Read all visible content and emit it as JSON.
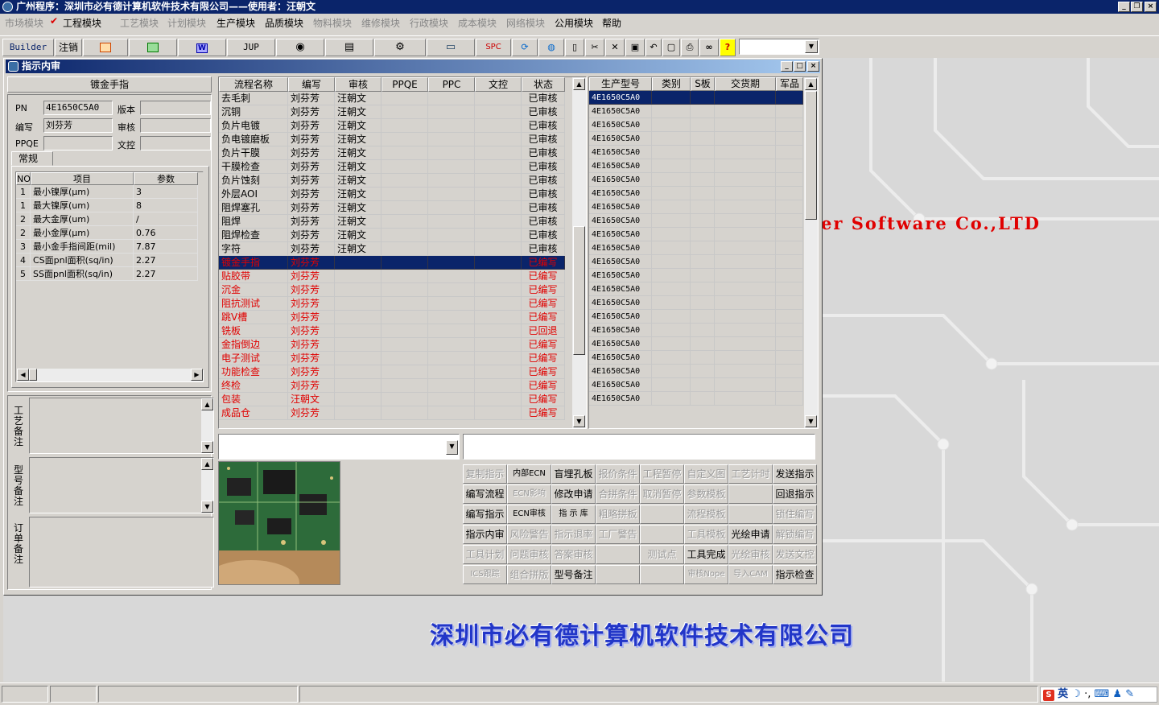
{
  "title_bar": {
    "title": "广州程序：深圳市必有德计算机软件技术有限公司——使用者：汪朝文"
  },
  "menu": [
    {
      "label": "市场模块",
      "enabled": false
    },
    {
      "label": "工程模块",
      "enabled": true,
      "checked": true
    },
    {
      "label": "工艺模块",
      "enabled": false
    },
    {
      "label": "计划模块",
      "enabled": false
    },
    {
      "label": "生产模块",
      "enabled": true
    },
    {
      "label": "品质模块",
      "enabled": true
    },
    {
      "label": "物料模块",
      "enabled": false
    },
    {
      "label": "维修模块",
      "enabled": false
    },
    {
      "label": "行政模块",
      "enabled": false
    },
    {
      "label": "成本模块",
      "enabled": false
    },
    {
      "label": "网络模块",
      "enabled": false
    },
    {
      "label": "公用模块",
      "enabled": true
    },
    {
      "label": "帮助",
      "enabled": true
    }
  ],
  "toolbar": {
    "builder": "Builder",
    "logout": "注销",
    "jup": "JUP",
    "spc": "SPC"
  },
  "desktop": {
    "company_en": "er Software Co.,LTD",
    "company_cn": "深圳市必有德计算机软件技术有限公司"
  },
  "window": {
    "title": "指示内审"
  },
  "left": {
    "header": "镀金手指",
    "pn_label": "PN",
    "pn_value": "4E1650C5A0",
    "version_label": "版本",
    "version_value": "",
    "author_label": "编写",
    "author_value": "刘芬芳",
    "review_label": "审核",
    "review_value": "",
    "ppqe_label": "PPQE",
    "ppqe_value": "",
    "doc_review_label": "文控",
    "doc_review_value": "",
    "tab_label": "常规",
    "param_headers": [
      "NO",
      "项目",
      "参数"
    ],
    "params": [
      [
        "1",
        "最小镍厚(μm)",
        "3"
      ],
      [
        "1",
        "最大镍厚(um)",
        "8"
      ],
      [
        "2",
        "最大金厚(um)",
        "/"
      ],
      [
        "2",
        "最小金厚(μm)",
        "0.76"
      ],
      [
        "3",
        "最小金手指间距(mil)",
        "7.87"
      ],
      [
        "4",
        "CS面pnl面积(sq/in)",
        "2.27"
      ],
      [
        "5",
        "SS面pnl面积(sq/in)",
        "2.27"
      ]
    ],
    "note1": "工艺备注",
    "note2": "型号备注",
    "note3": "订单备注"
  },
  "process": {
    "headers": [
      "流程名称",
      "编写",
      "审核",
      "PPQE",
      "PPC",
      "文控",
      "状态"
    ],
    "rows": [
      [
        "去毛刺",
        "刘芬芳",
        "汪朝文",
        "",
        "",
        "",
        "已审核"
      ],
      [
        "沉铜",
        "刘芬芳",
        "汪朝文",
        "",
        "",
        "",
        "已审核"
      ],
      [
        "负片电镀",
        "刘芬芳",
        "汪朝文",
        "",
        "",
        "",
        "已审核"
      ],
      [
        "负电镀磨板",
        "刘芬芳",
        "汪朝文",
        "",
        "",
        "",
        "已审核"
      ],
      [
        "负片干膜",
        "刘芬芳",
        "汪朝文",
        "",
        "",
        "",
        "已审核"
      ],
      [
        "干膜检查",
        "刘芬芳",
        "汪朝文",
        "",
        "",
        "",
        "已审核"
      ],
      [
        "负片蚀刻",
        "刘芬芳",
        "汪朝文",
        "",
        "",
        "",
        "已审核"
      ],
      [
        "外层AOI",
        "刘芬芳",
        "汪朝文",
        "",
        "",
        "",
        "已审核"
      ],
      [
        "阻焊塞孔",
        "刘芬芳",
        "汪朝文",
        "",
        "",
        "",
        "已审核"
      ],
      [
        "阻焊",
        "刘芬芳",
        "汪朝文",
        "",
        "",
        "",
        "已审核"
      ],
      [
        "阻焊检查",
        "刘芬芳",
        "汪朝文",
        "",
        "",
        "",
        "已审核"
      ],
      [
        "字符",
        "刘芬芳",
        "汪朝文",
        "",
        "",
        "",
        "已审核"
      ],
      [
        "镀金手指",
        "刘芬芳",
        "",
        "",
        "",
        "",
        "已编写"
      ],
      [
        "贴胶带",
        "刘芬芳",
        "",
        "",
        "",
        "",
        "已编写"
      ],
      [
        "沉金",
        "刘芬芳",
        "",
        "",
        "",
        "",
        "已编写"
      ],
      [
        "阻抗测试",
        "刘芬芳",
        "",
        "",
        "",
        "",
        "已编写"
      ],
      [
        "跳V槽",
        "刘芬芳",
        "",
        "",
        "",
        "",
        "已编写"
      ],
      [
        "铣板",
        "刘芬芳",
        "",
        "",
        "",
        "",
        "已回退"
      ],
      [
        "金指倒边",
        "刘芬芳",
        "",
        "",
        "",
        "",
        "已编写"
      ],
      [
        "电子测试",
        "刘芬芳",
        "",
        "",
        "",
        "",
        "已编写"
      ],
      [
        "功能检查",
        "刘芬芳",
        "",
        "",
        "",
        "",
        "已编写"
      ],
      [
        "终检",
        "刘芬芳",
        "",
        "",
        "",
        "",
        "已编写"
      ],
      [
        "包装",
        "汪朝文",
        "",
        "",
        "",
        "",
        "已编写"
      ],
      [
        "成品仓",
        "刘芬芳",
        "",
        "",
        "",
        "",
        "已编写"
      ]
    ],
    "selected_index": 12,
    "first_red_index": 12
  },
  "models": {
    "headers": [
      "生产型号",
      "类别",
      "S板",
      "交货期",
      "军品"
    ],
    "rows": [
      "4E1650C5A0",
      "4E1650C5A0",
      "4E1650C5A0",
      "4E1650C5A0",
      "4E1650C5A0",
      "4E1650C5A0",
      "4E1650C5A0",
      "4E1650C5A0",
      "4E1650C5A0",
      "4E1650C5A0",
      "4E1650C5A0",
      "4E1650C5A0",
      "4E1650C5A0",
      "4E1650C5A0",
      "4E1650C5A0",
      "4E1650C5A0",
      "4E1650C5A0",
      "4E1650C5A0",
      "4E1650C5A0",
      "4E1650C5A0",
      "4E1650C5A0",
      "4E1650C5A0",
      "4E1650C5A0"
    ]
  },
  "buttons": [
    [
      "复制指示",
      "内部ECN",
      "盲埋孔板",
      "报价条件",
      "工程暂停",
      "自定义图",
      "工艺计时",
      "发送指示"
    ],
    [
      "编写流程",
      "ECN影响",
      "修改申请",
      "合拼条件",
      "取消暂停",
      "参数模板",
      "",
      "回退指示"
    ],
    [
      "编写指示",
      "ECN审核",
      "指 示 库",
      "粗略拼板",
      "",
      "流程模板",
      "",
      "锁住编写"
    ],
    [
      "指示内审",
      "风险警告",
      "指示退率",
      "工厂警告",
      "",
      "工具模板",
      "光绘申请",
      "解锁编写"
    ],
    [
      "工具计划",
      "问题审核",
      "答案审核",
      "",
      "测试点",
      "工具完成",
      "光绘审核",
      "发送文控"
    ],
    [
      "ICS跟踪",
      "组合拼版",
      "型号备注",
      "",
      "",
      "审核Nope",
      "导入CAM",
      "指示检查"
    ]
  ],
  "buttons_enabled": [
    [
      false,
      true,
      true,
      false,
      false,
      false,
      false,
      true
    ],
    [
      true,
      false,
      true,
      false,
      false,
      false,
      false,
      true
    ],
    [
      true,
      true,
      true,
      false,
      false,
      false,
      false,
      false
    ],
    [
      true,
      false,
      false,
      false,
      false,
      false,
      true,
      false
    ],
    [
      false,
      false,
      false,
      false,
      false,
      true,
      false,
      false
    ],
    [
      false,
      false,
      true,
      false,
      false,
      false,
      false,
      true
    ]
  ],
  "tray": {
    "ime": "英"
  }
}
